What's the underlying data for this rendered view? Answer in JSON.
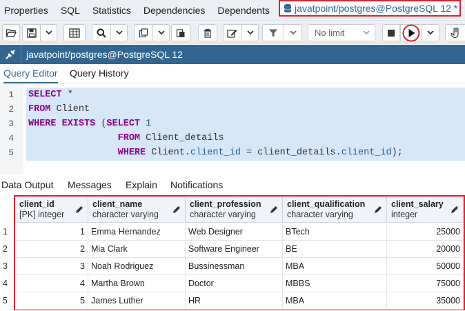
{
  "top_tabs": [
    "Properties",
    "SQL",
    "Statistics",
    "Dependencies",
    "Dependents"
  ],
  "active_tab": {
    "label": "javatpoint/postgres@PostgreSQL 12 *",
    "icon": "database-icon"
  },
  "toolbar": {
    "limit_label": "No limit"
  },
  "title_bar": {
    "icon": "connection-icon",
    "label": "javatpoint/postgres@PostgreSQL 12"
  },
  "sub_tabs": [
    "Query Editor",
    "Query History"
  ],
  "editor": {
    "line_numbers": [
      "1",
      "2",
      "3",
      "4",
      "5"
    ],
    "lines": [
      [
        {
          "t": "SELECT",
          "c": "kw"
        },
        {
          "t": " *",
          "c": ""
        }
      ],
      [
        {
          "t": "FROM",
          "c": "kw"
        },
        {
          "t": " Client",
          "c": ""
        }
      ],
      [
        {
          "t": "WHERE EXISTS",
          "c": "kw"
        },
        {
          "t": " (",
          "c": ""
        },
        {
          "t": "SELECT",
          "c": "kw"
        },
        {
          "t": " ",
          "c": ""
        },
        {
          "t": "1",
          "c": "num"
        }
      ],
      [
        {
          "t": "                ",
          "c": ""
        },
        {
          "t": "FROM",
          "c": "kw"
        },
        {
          "t": " Client_details",
          "c": ""
        }
      ],
      [
        {
          "t": "                ",
          "c": ""
        },
        {
          "t": "WHERE",
          "c": "kw"
        },
        {
          "t": " Client.",
          "c": ""
        },
        {
          "t": "client_id",
          "c": "prop"
        },
        {
          "t": " = client_details.",
          "c": ""
        },
        {
          "t": "client_id",
          "c": "prop"
        },
        {
          "t": ");",
          "c": ""
        }
      ]
    ]
  },
  "output_tabs": [
    "Data Output",
    "Messages",
    "Explain",
    "Notifications"
  ],
  "grid": {
    "columns": [
      {
        "name": "client_id",
        "type": "[PK] integer"
      },
      {
        "name": "client_name",
        "type": "character varying"
      },
      {
        "name": "client_profession",
        "type": "character varying"
      },
      {
        "name": "client_qualification",
        "type": "character varying"
      },
      {
        "name": "client_salary",
        "type": "integer"
      }
    ],
    "rows": [
      {
        "n": "1",
        "cells": [
          "1",
          "Emma Hernandez",
          "Web Designer",
          "BTech",
          "25000"
        ]
      },
      {
        "n": "2",
        "cells": [
          "2",
          "Mia Clark",
          "Software Engineer",
          "BE",
          "20000"
        ]
      },
      {
        "n": "3",
        "cells": [
          "3",
          "Noah Rodriguez",
          "Bussinessman",
          "MBA",
          "50000"
        ]
      },
      {
        "n": "4",
        "cells": [
          "4",
          "Martha Brown",
          "Doctor",
          "MBBS",
          "75000"
        ]
      },
      {
        "n": "5",
        "cells": [
          "5",
          "James Luther",
          "HR",
          "MBA",
          "35000"
        ]
      }
    ]
  },
  "colors": {
    "accent": "#326690",
    "highlight": "#d9232e",
    "selection": "#d7e7f7",
    "keyword": "#8b008b"
  }
}
